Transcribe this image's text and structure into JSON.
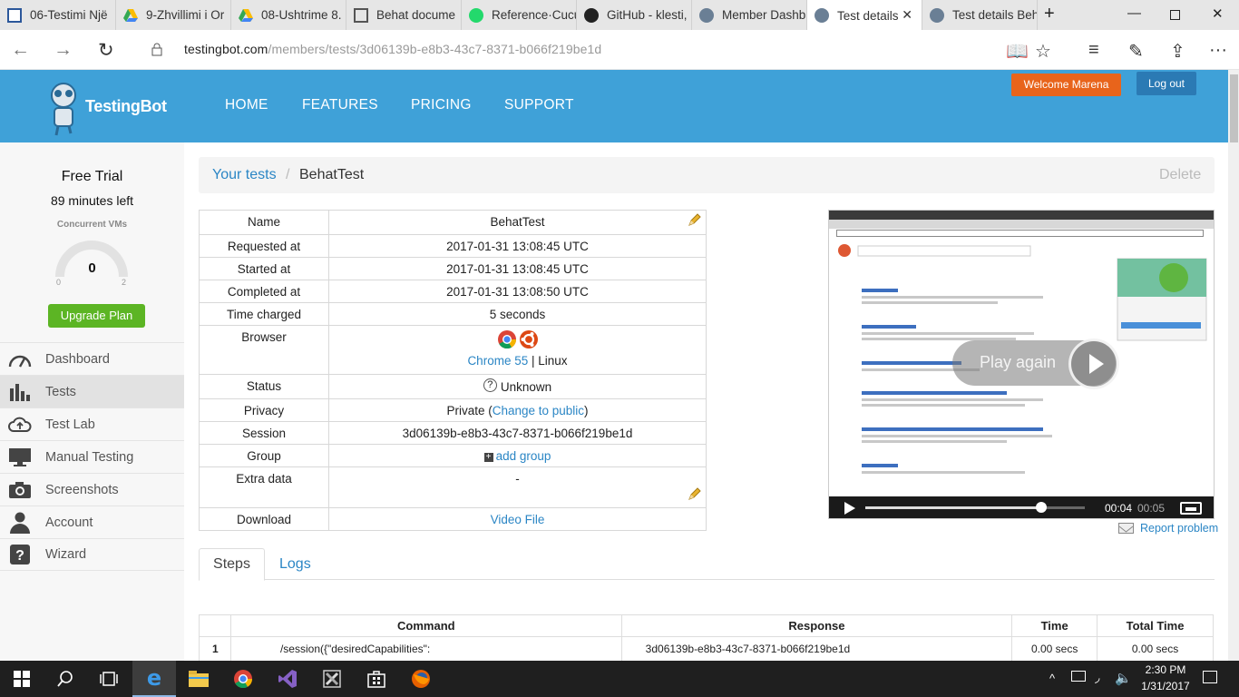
{
  "browser": {
    "tabs": [
      {
        "label": "06-Testimi Një",
        "icon": "word-doc-icon"
      },
      {
        "label": "9-Zhvillimi i Or",
        "icon": "google-drive-icon"
      },
      {
        "label": "08-Ushtrime 8.",
        "icon": "google-drive-icon"
      },
      {
        "label": "Behat docume",
        "icon": "behat-doc-icon"
      },
      {
        "label": "Reference·Cucu",
        "icon": "cucumber-icon"
      },
      {
        "label": "GitHub - klesti,",
        "icon": "github-icon"
      },
      {
        "label": "Member Dashb",
        "icon": "testingbot-icon"
      },
      {
        "label": "Test details",
        "icon": "testingbot-icon"
      },
      {
        "label": "Test details Beh",
        "icon": "testingbot-icon"
      }
    ],
    "url_domain": "testingbot.com",
    "url_path": "/members/tests/3d06139b-e8b3-43c7-8371-b066f219be1d"
  },
  "header": {
    "logo_text": "TestingBot",
    "menu": [
      "HOME",
      "FEATURES",
      "PRICING",
      "SUPPORT"
    ],
    "welcome": "Welcome Marena",
    "logout": "Log out",
    "color": "#3fa1d8"
  },
  "sidebar": {
    "plan": "Free Trial",
    "minutes": "89 minutes left",
    "vms_label": "Concurrent VMs",
    "vms_value": "0",
    "gauge_min": "0",
    "gauge_max": "2",
    "upgrade": "Upgrade Plan",
    "items": [
      {
        "label": "Dashboard",
        "icon": "dashboard-icon"
      },
      {
        "label": "Tests",
        "icon": "bar-chart-icon"
      },
      {
        "label": "Test Lab",
        "icon": "cloud-upload-icon"
      },
      {
        "label": "Manual Testing",
        "icon": "monitor-icon"
      },
      {
        "label": "Screenshots",
        "icon": "camera-icon"
      },
      {
        "label": "Account",
        "icon": "user-icon"
      },
      {
        "label": "Wizard",
        "icon": "question-icon"
      }
    ]
  },
  "breadcrumb": {
    "parent": "Your tests",
    "sep": "/",
    "current": "BehatTest",
    "delete": "Delete"
  },
  "details": {
    "name_label": "Name",
    "name": "BehatTest",
    "requested_label": "Requested at",
    "requested": "2017-01-31 13:08:45 UTC",
    "started_label": "Started at",
    "started": "2017-01-31 13:08:45 UTC",
    "completed_label": "Completed at",
    "completed": "2017-01-31 13:08:50 UTC",
    "charged_label": "Time charged",
    "charged": "5 seconds",
    "browser_label": "Browser",
    "browser": "Chrome 55",
    "os_sep": "|",
    "os": "Linux",
    "status_label": "Status",
    "status": "Unknown",
    "privacy_label": "Privacy",
    "privacy_prefix": "Private (",
    "privacy_link": "Change to public",
    "privacy_suffix": ")",
    "session_label": "Session",
    "session": "3d06139b-e8b3-43c7-8371-b066f219be1d",
    "group_label": "Group",
    "group_link": "add group",
    "extra_label": "Extra data",
    "extra": "-",
    "download_label": "Download",
    "download_link": "Video File"
  },
  "video": {
    "play_again": "Play again",
    "current_time": "00:04",
    "duration": "00:05",
    "progress": 0.8,
    "report": "Report problem"
  },
  "tabs": {
    "steps": "Steps",
    "logs": "Logs"
  },
  "steps_table": {
    "headers": [
      "Command",
      "Response",
      "Time",
      "Total Time"
    ],
    "rows": [
      {
        "num": "1",
        "command": "/session({\"desiredCapabilities\":",
        "response": "3d06139b-e8b3-43c7-8371-b066f219be1d",
        "time": "0.00 secs",
        "total": "0.00 secs"
      }
    ]
  },
  "taskbar": {
    "time": "2:30 PM",
    "date": "1/31/2017"
  }
}
